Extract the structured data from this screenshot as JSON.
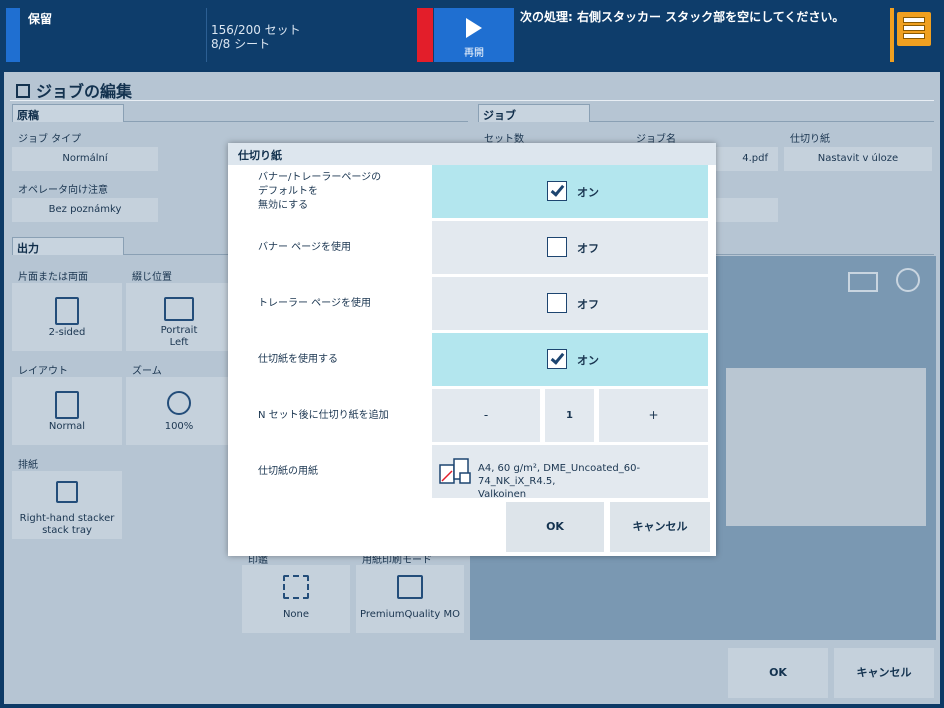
{
  "topbar": {
    "status": "保留",
    "sets": "156/200 セット",
    "sheets": "8/8 シート",
    "resume_label": "再開",
    "next_action": "次の処理: 右側スタッカー スタック部を空にしてください。"
  },
  "window": {
    "title": "ジョブの編集",
    "sections": {
      "original": "原稿",
      "job": "ジョブ",
      "output": "出力"
    },
    "fields": {
      "job_type_label": "ジョブ タイプ",
      "job_type_value": "Normální",
      "operator_note_label": "オペレータ向け注意",
      "operator_note_value": "Bez poznámky",
      "sets_label": "セット数",
      "job_name_label": "ジョブ名",
      "job_name_value": "4.pdf",
      "separator_label": "仕切り紙",
      "separator_value": "Nastavit v úloze"
    },
    "output_tiles": [
      {
        "label": "片面または両面",
        "value": "2-sided"
      },
      {
        "label": "綴じ位置",
        "value": "Portrait\nLeft"
      },
      {
        "label": "レイアウト",
        "value": "Normal"
      },
      {
        "label": "ズーム",
        "value": "100%"
      },
      {
        "label": "排紙",
        "value": "Right-hand stacker\nstack tray"
      },
      {
        "label": "印鑑",
        "value": "None"
      },
      {
        "label": "用紙印刷モード",
        "value": "PremiumQuality MO"
      }
    ],
    "bottom": {
      "ok": "OK",
      "cancel": "キャンセル"
    }
  },
  "dialog": {
    "title": "仕切り紙",
    "rows": [
      {
        "label": "バナー/トレーラーページの\nデフォルトを\n無効にする",
        "state": "オン",
        "checked": true
      },
      {
        "label": "バナー ページを使用",
        "state": "オフ",
        "checked": false
      },
      {
        "label": "トレーラー ページを使用",
        "state": "オフ",
        "checked": false
      },
      {
        "label": "仕切紙を使用する",
        "state": "オン",
        "checked": true
      }
    ],
    "nsets": {
      "label": "N セット後に仕切り紙を追加",
      "minus": "-",
      "value": "1",
      "plus": "+"
    },
    "media": {
      "label": "仕切紙の用紙",
      "line1": "A4, 60 g/m², DME_Uncoated_60-74_NK_iX_R4.5,",
      "line2": "Valkoinen"
    },
    "ok": "OK",
    "cancel": "キャンセル"
  }
}
